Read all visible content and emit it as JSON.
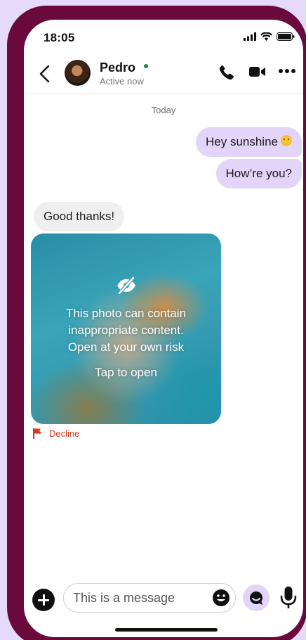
{
  "status_bar": {
    "time": "18:05"
  },
  "contact": {
    "name": "Pedro",
    "status": "Active now"
  },
  "conversation": {
    "day_label": "Today",
    "messages": [
      {
        "direction": "outgoing",
        "text": "Hey sunshine",
        "emoji": "smiling-face"
      },
      {
        "direction": "outgoing",
        "text": "How’re you?"
      },
      {
        "direction": "incoming",
        "text": "Good thanks!"
      }
    ],
    "media": {
      "warning_line1": "This photo can contain",
      "warning_line2": "inappropriate content.",
      "warning_line3": "Open at your own risk",
      "tap_label": "Tap to open",
      "icon": "eye-slash-icon"
    },
    "decline_label": "Decline"
  },
  "composer": {
    "placeholder": "This is a message"
  },
  "colors": {
    "frame": "#6a0a3c",
    "background": "#e6dafa",
    "outgoing_bubble": "#e3d5f9",
    "incoming_bubble": "#efefef",
    "decline": "#d63a1c",
    "online": "#1a8b3c"
  }
}
